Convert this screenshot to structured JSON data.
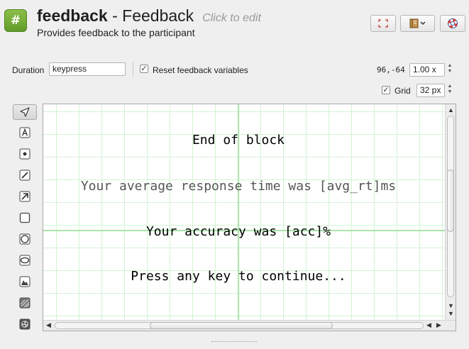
{
  "header": {
    "icon_glyph": "#",
    "item_name": "feedback",
    "separator": " - ",
    "item_type": "Feedback",
    "edit_hint": "Click to edit",
    "description": "Provides feedback to the participant",
    "buttons": [
      {
        "name": "maximize-button",
        "icon": "maximize-icon"
      },
      {
        "name": "view-menu-button",
        "icon": "notebook-icon"
      },
      {
        "name": "help-button",
        "icon": "lifebuoy-icon"
      }
    ]
  },
  "options": {
    "duration_label": "Duration",
    "duration_value": "keypress",
    "reset_label": "Reset feedback variables",
    "reset_checked": true,
    "coords": "96,-64",
    "zoom": "1.00 x",
    "grid_label": "Grid",
    "grid_checked": true,
    "grid_size": "32 px"
  },
  "tools": [
    {
      "name": "select-tool",
      "icon": "arrow-pointer-icon",
      "active": true
    },
    {
      "name": "text-tool",
      "icon": "text-icon",
      "active": false
    },
    {
      "name": "fixdot-tool",
      "icon": "fixdot-icon",
      "active": false
    },
    {
      "name": "line-tool",
      "icon": "line-icon",
      "active": false
    },
    {
      "name": "arrow-tool",
      "icon": "arrow-icon",
      "active": false
    },
    {
      "name": "rect-tool",
      "icon": "rectangle-icon",
      "active": false
    },
    {
      "name": "circle-tool",
      "icon": "circle-icon",
      "active": false
    },
    {
      "name": "ellipse-tool",
      "icon": "ellipse-icon",
      "active": false
    },
    {
      "name": "image-tool",
      "icon": "image-icon",
      "active": false
    },
    {
      "name": "gabor-tool",
      "icon": "gabor-icon",
      "active": false
    },
    {
      "name": "noise-tool",
      "icon": "noise-icon",
      "active": false
    }
  ],
  "canvas": {
    "grid_color": "#d4f2d4",
    "axis_color": "#a9e6a9",
    "texts": [
      {
        "text": "End of block",
        "color": "#000000"
      },
      {
        "text": "Your average response time was [avg_rt]ms",
        "color": "#555555"
      },
      {
        "text": "Your accuracy was [acc]%",
        "color": "#000000"
      },
      {
        "text": "Press any key to continue...",
        "color": "#000000"
      }
    ]
  }
}
